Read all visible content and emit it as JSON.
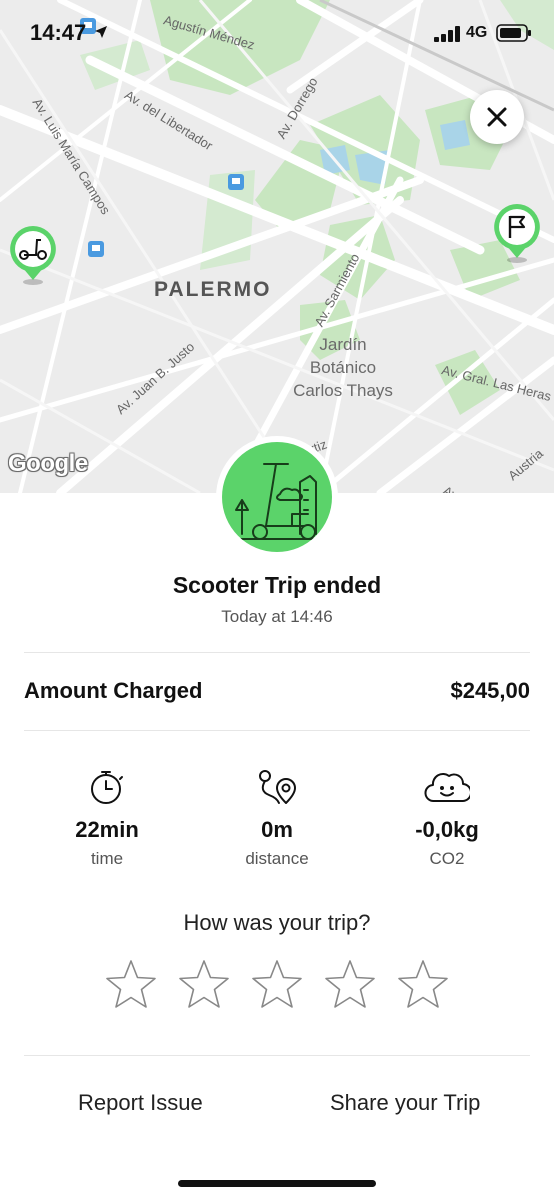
{
  "status_bar": {
    "time": "14:47",
    "network": "4G",
    "icons": [
      "location-arrow-icon",
      "signal-bars-icon",
      "battery-icon"
    ]
  },
  "map": {
    "street_labels": [
      "Agustín Méndez",
      "Av. del Libertador",
      "Av. Luis María Campos",
      "Av. Dorrego",
      "Av. Sarmiento",
      "Av. Juan B. Justo",
      "Av. Gral. Las Heras",
      "Austria",
      "rtiz",
      "Av. S"
    ],
    "district": "PALERMO",
    "poi": "Jardín Botánico Carlos Thays",
    "attribution": "Google",
    "pins": [
      "scooter-pin",
      "finish-flag-pin"
    ]
  },
  "header": {
    "close_icon": "close-icon"
  },
  "trip": {
    "title": "Scooter Trip ended",
    "time": "Today at 14:46"
  },
  "charge": {
    "label": "Amount Charged",
    "value": "$245,00"
  },
  "stats": [
    {
      "icon": "stopwatch-icon",
      "value": "22min",
      "label": "time"
    },
    {
      "icon": "route-distance-icon",
      "value": "0m",
      "label": "distance"
    },
    {
      "icon": "cloud-smile-icon",
      "value": "-0,0kg",
      "label": "CO2"
    }
  ],
  "rating": {
    "question": "How was your trip?",
    "stars_max": 5,
    "stars_value": 0
  },
  "actions": {
    "report": "Report Issue",
    "share": "Share your Trip"
  },
  "colors": {
    "accent_green": "#5bd36a",
    "map_background": "#ececec",
    "park_green": "#c8e6c0"
  }
}
